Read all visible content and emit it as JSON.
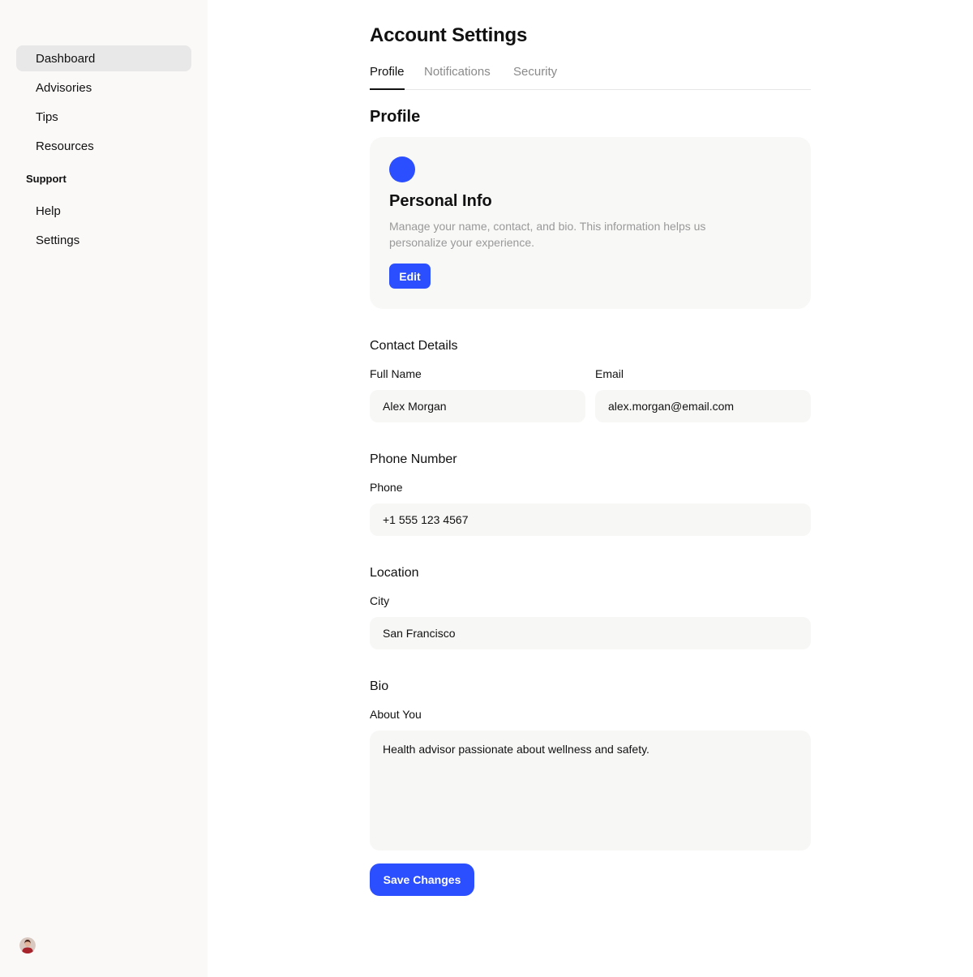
{
  "colors": {
    "accent": "#2b4eff",
    "sidebar_bg": "#faf9f8",
    "active_nav_bg": "#e8e8e8"
  },
  "sidebar": {
    "items": [
      {
        "label": "Dashboard",
        "active": true
      },
      {
        "label": "Advisories"
      },
      {
        "label": "Tips"
      },
      {
        "label": "Resources"
      }
    ],
    "section_label": "Support",
    "support_items": [
      {
        "label": "Help"
      },
      {
        "label": "Settings"
      }
    ],
    "avatar_icon": "user-avatar"
  },
  "main": {
    "title": "Account Settings",
    "tabs": [
      {
        "label": "Profile",
        "active": true
      },
      {
        "label": "Notifications"
      },
      {
        "label": "Security"
      }
    ],
    "section_title": "Profile",
    "card": {
      "icon": "circle-icon",
      "title": "Personal Info",
      "description": "Manage your name, contact, and bio. This information helps us personalize your experience.",
      "button_label": "Edit"
    },
    "contact": {
      "title": "Contact Details",
      "full_name_label": "Full Name",
      "full_name_value": "Alex Morgan",
      "email_label": "Email",
      "email_value": "alex.morgan@email.com"
    },
    "phone": {
      "title": "Phone Number",
      "label": "Phone",
      "value": "+1 555 123 4567"
    },
    "location": {
      "title": "Location",
      "label": "City",
      "value": "San Francisco"
    },
    "bio": {
      "title": "Bio",
      "label": "About You",
      "value": "Health advisor passionate about wellness and safety."
    },
    "save_label": "Save Changes"
  }
}
